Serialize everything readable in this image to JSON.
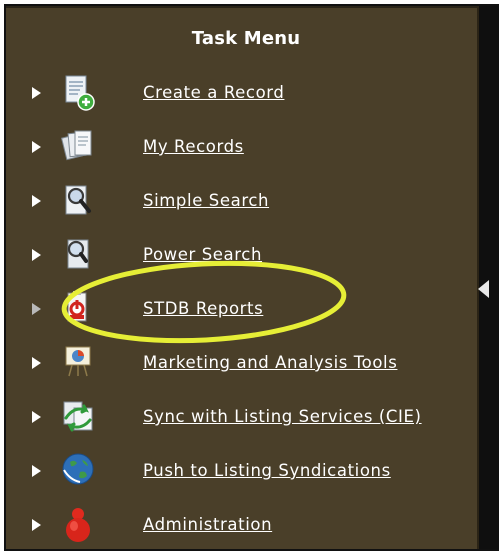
{
  "panel": {
    "title": "Task Menu"
  },
  "menu": {
    "items": [
      {
        "label": "Create a Record",
        "icon": "document-add-icon"
      },
      {
        "label": "My Records",
        "icon": "records-stack-icon"
      },
      {
        "label": "Simple Search",
        "icon": "magnifier-document-icon"
      },
      {
        "label": "Power Search",
        "icon": "magnifier-document-icon"
      },
      {
        "label": "STDB Reports",
        "icon": "reports-clipboard-icon",
        "highlighted": true
      },
      {
        "label": "Marketing and Analysis Tools",
        "icon": "easel-chart-icon"
      },
      {
        "label": "Sync with Listing Services (CIE)",
        "icon": "sync-arrows-icon"
      },
      {
        "label": "Push to Listing Syndications",
        "icon": "globe-icon"
      },
      {
        "label": "Administration",
        "icon": "admin-gear-icon"
      }
    ]
  },
  "colors": {
    "panel_background": "#4a3f29",
    "highlight_ring": "#e6ee36",
    "text": "#ffffff"
  }
}
